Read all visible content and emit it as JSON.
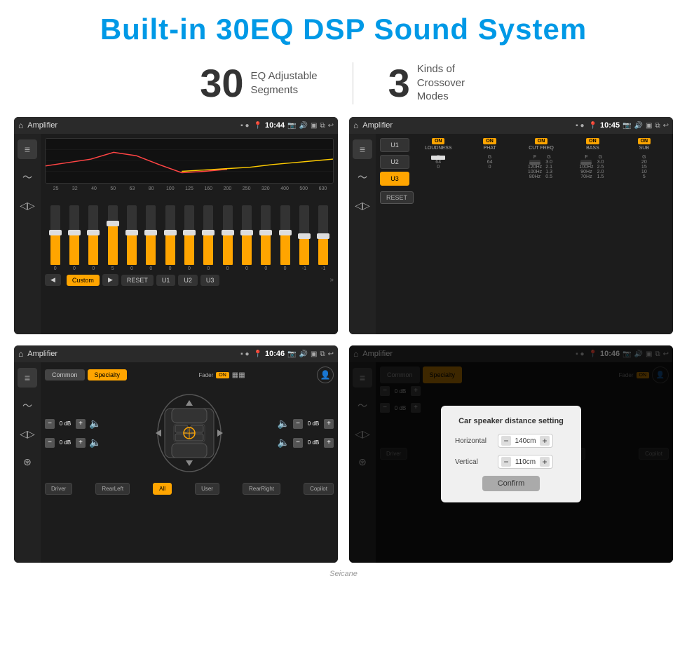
{
  "header": {
    "title": "Built-in 30EQ DSP Sound System"
  },
  "stats": [
    {
      "number": "30",
      "label": "EQ Adjustable\nSegments"
    },
    {
      "number": "3",
      "label": "Kinds of\nCrossover Modes"
    }
  ],
  "screens": [
    {
      "id": "screen1",
      "topbar": {
        "title": "Amplifier",
        "time": "10:44"
      },
      "type": "equalizer",
      "frequencies": [
        "25",
        "32",
        "40",
        "50",
        "63",
        "80",
        "100",
        "125",
        "160",
        "200",
        "250",
        "320",
        "400",
        "500",
        "630"
      ],
      "preset_label": "Custom",
      "buttons": [
        "RESET",
        "U1",
        "U2",
        "U3"
      ]
    },
    {
      "id": "screen2",
      "topbar": {
        "title": "Amplifier",
        "time": "10:45"
      },
      "type": "crossover",
      "presets": [
        "U1",
        "U2",
        "U3"
      ],
      "active_preset": "U3",
      "bands": [
        "LOUDNESS",
        "PHAT",
        "CUT FREQ",
        "BASS",
        "SUB"
      ],
      "reset_label": "RESET"
    },
    {
      "id": "screen3",
      "topbar": {
        "title": "Amplifier",
        "time": "10:46"
      },
      "type": "speaker",
      "tabs": [
        "Common",
        "Specialty"
      ],
      "active_tab": "Specialty",
      "fader_label": "Fader",
      "fader_state": "ON",
      "db_values": [
        "0 dB",
        "0 dB",
        "0 dB",
        "0 dB"
      ],
      "speaker_positions": [
        "Driver",
        "RearLeft",
        "All",
        "User",
        "RearRight",
        "Copilot"
      ]
    },
    {
      "id": "screen4",
      "topbar": {
        "title": "Amplifier",
        "time": "10:46"
      },
      "type": "speaker_distance",
      "tabs": [
        "Common",
        "Specialty"
      ],
      "active_tab": "Specialty",
      "modal": {
        "title": "Car speaker distance setting",
        "horizontal_label": "Horizontal",
        "horizontal_value": "140cm",
        "vertical_label": "Vertical",
        "vertical_value": "110cm",
        "confirm_label": "Confirm"
      }
    }
  ],
  "brand": "Seicane"
}
